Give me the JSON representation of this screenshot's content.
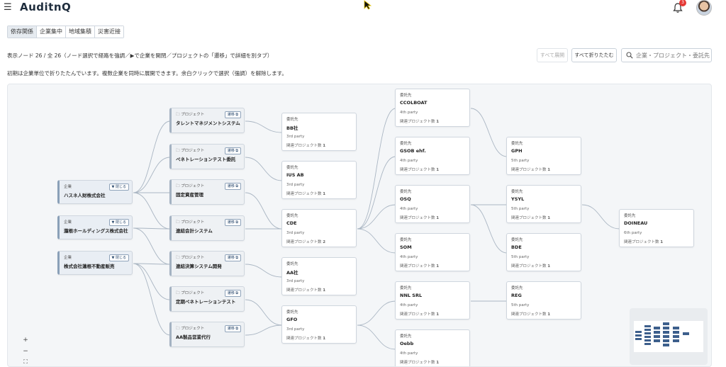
{
  "header": {
    "logo_text": "AuditnQ",
    "menu_icon": "hamburger-menu-icon",
    "notification_count": "3"
  },
  "tabs": [
    {
      "label": "依存関係",
      "active": true
    },
    {
      "label": "企業集中",
      "active": false
    },
    {
      "label": "地域集積",
      "active": false
    },
    {
      "label": "災害近接",
      "active": false
    }
  ],
  "info": {
    "line1": "表示ノード 26 / 全 26（ノード選択で経路を強調／▶で企業を開閉／プロジェクトの「遷移」で詳細を別タブ）",
    "line2": "初期は企業単位で折りたたんでいます。複数企業を同時に展開できます。余白クリックで選択（強調）を解除します。"
  },
  "toolbar": {
    "expand_all": "すべて展開",
    "collapse_all": "すべて折りたたむ",
    "search_placeholder": "企業・プロジェクト・委託先を検索"
  },
  "labels": {
    "company": "企業",
    "project": "プロジェクト",
    "vendor": "委託先",
    "close_chip": "閉じる",
    "transition_chip": "遷移",
    "related_prefix": "関連プロジェクト数"
  },
  "companies": [
    {
      "name": "ハスネ人財株式会社"
    },
    {
      "name": "瀧根ホールディングス株式会社"
    },
    {
      "name": "株式会社蓮根不動産販売"
    }
  ],
  "projects": [
    {
      "name": "タレントマネジメントシステム"
    },
    {
      "name": "ペネトレーションテスト委託"
    },
    {
      "name": "固定資産管理"
    },
    {
      "name": "連結会計システム"
    },
    {
      "name": "連結決算システム開発"
    },
    {
      "name": "定期ペネトレーションテスト"
    },
    {
      "name": "AA製品営業代行"
    }
  ],
  "vendors": [
    {
      "id": "bb",
      "name": "BB社",
      "party": "3rd party",
      "count": "1"
    },
    {
      "id": "ius",
      "name": "IUS AB",
      "party": "3rd party",
      "count": "1"
    },
    {
      "id": "cde",
      "name": "CDE",
      "party": "3rd party",
      "count": "2"
    },
    {
      "id": "aa",
      "name": "AA社",
      "party": "3rd party",
      "count": "1"
    },
    {
      "id": "gfo",
      "name": "GFO",
      "party": "3rd party",
      "count": "1"
    },
    {
      "id": "ccol",
      "name": "CCOLBOAT",
      "party": "4th party",
      "count": "1"
    },
    {
      "id": "gsob",
      "name": "GSOB ehf.",
      "party": "4th party",
      "count": "1"
    },
    {
      "id": "osq",
      "name": "OSQ",
      "party": "4th party",
      "count": "1"
    },
    {
      "id": "som",
      "name": "SOM",
      "party": "4th party",
      "count": "1"
    },
    {
      "id": "nnl",
      "name": "NNL SRL",
      "party": "4th party",
      "count": "1"
    },
    {
      "id": "oebb",
      "name": "Oebb",
      "party": "4th party",
      "count": "1"
    },
    {
      "id": "gph",
      "name": "GPH",
      "party": "5th party",
      "count": "1"
    },
    {
      "id": "ysyl",
      "name": "YSYL",
      "party": "5th party",
      "count": "1"
    },
    {
      "id": "bde",
      "name": "BDE",
      "party": "5th party",
      "count": "1"
    },
    {
      "id": "reg",
      "name": "REG",
      "party": "5th party",
      "count": "1"
    },
    {
      "id": "doin",
      "name": "DOINEAU",
      "party": "6th party",
      "count": "1"
    }
  ],
  "zoom": {
    "plus": "+",
    "minus": "−",
    "fit": "⛶"
  }
}
